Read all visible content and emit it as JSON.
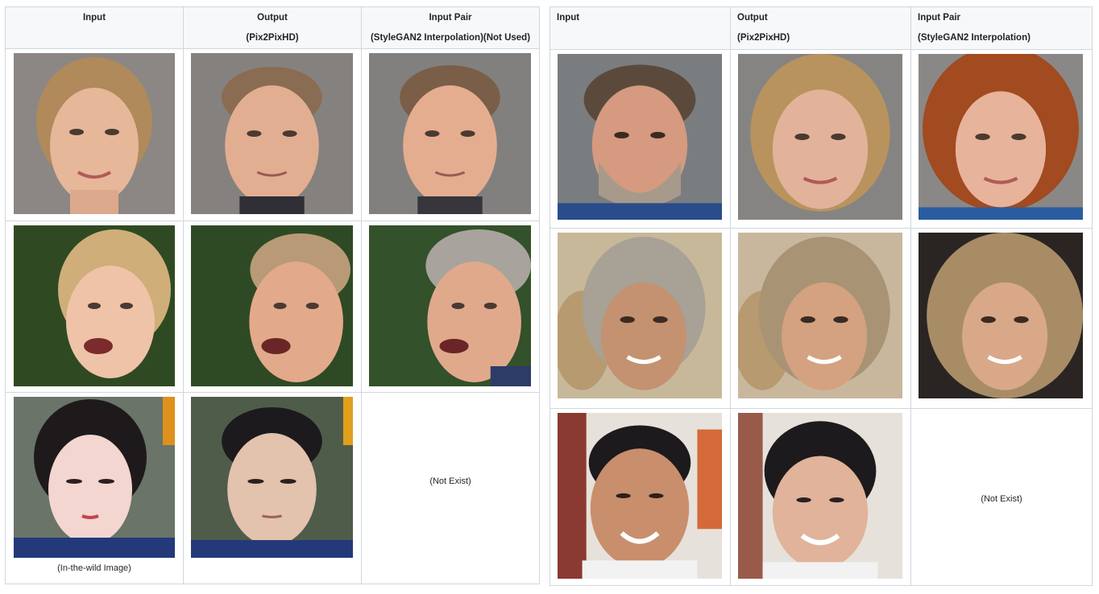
{
  "left_table": {
    "headers": {
      "input": "Input",
      "output_line1": "Output",
      "output_line2": "(Pix2PixHD)",
      "pair_line1": "Input Pair",
      "pair_line2": "(StyleGAN2 Interpolation)(Not Used)"
    },
    "rows": [
      {
        "input_photo": "blonde woman, grey background",
        "output_photo": "man with short hair, grey background",
        "pair_photo": "man with short hair, grey background"
      },
      {
        "input_photo": "blonde woman laughing, green background",
        "output_photo": "man with open mouth, green background",
        "pair_photo": "grey-haired man with open mouth, green background"
      },
      {
        "input_photo": "young woman with dark hair",
        "output_photo": "young man with dark hair",
        "pair_text": "(Not Exist)",
        "caption": "(In-the-wild Image)"
      }
    ]
  },
  "right_table": {
    "headers": {
      "input": "Input",
      "output_line1": "Output",
      "output_line2": "(Pix2PixHD)",
      "pair_line1": "Input Pair",
      "pair_line2": "(StyleGAN2 Interpolation)"
    },
    "rows": [
      {
        "input_photo": "bearded man, grey background",
        "output_photo": "woman with blonde hair",
        "pair_photo": "woman with curly red hair"
      },
      {
        "input_photo": "older man with grey hair",
        "output_photo": "woman with light hair",
        "pair_photo": "woman with wavy hair"
      },
      {
        "input_photo": "smiling man with dark hair",
        "output_photo": "smiling woman with dark hair",
        "pair_text": "(Not Exist)"
      }
    ]
  },
  "colors": {
    "border": "#d0d7de",
    "header_bg": "#f6f8fa",
    "text": "#1f2328"
  }
}
